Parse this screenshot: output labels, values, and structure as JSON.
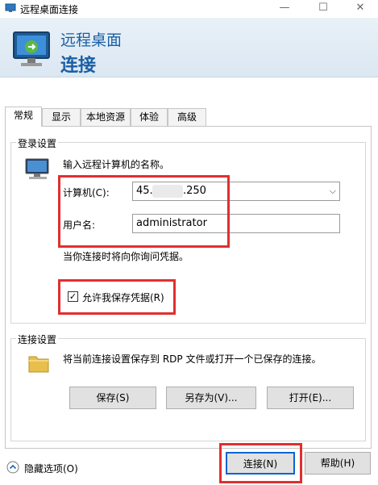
{
  "window": {
    "title": "远程桌面连接",
    "minimize": "—",
    "maximize": "☐",
    "close": "✕"
  },
  "banner": {
    "subtitle": "远程桌面",
    "title": "连接"
  },
  "tabs": [
    {
      "label": "常规",
      "active": true
    },
    {
      "label": "显示",
      "active": false
    },
    {
      "label": "本地资源",
      "active": false
    },
    {
      "label": "体验",
      "active": false
    },
    {
      "label": "高级",
      "active": false
    }
  ],
  "login": {
    "group_title": "登录设置",
    "instruction": "输入远程计算机的名称。",
    "computer_label": "计算机(C):",
    "computer_value_prefix": "45.1",
    "computer_value_suffix": ".250",
    "username_label": "用户名:",
    "username_value": "administrator",
    "credential_note": "当你连接时将向你询问凭据。",
    "save_credentials_label": "允许我保存凭据(R)",
    "save_credentials_checked": true
  },
  "connection": {
    "group_title": "连接设置",
    "description": "将当前连接设置保存到 RDP 文件或打开一个已保存的连接。",
    "save_label": "保存(S)",
    "save_as_label": "另存为(V)...",
    "open_label": "打开(E)..."
  },
  "footer": {
    "hide_options_label": "隐藏选项(O)",
    "connect_label": "连接(N)",
    "help_label": "帮助(H)"
  },
  "colors": {
    "accent": "#1a5fa5",
    "highlight_box": "#e02f2f",
    "primary_border": "#0a64d2"
  },
  "icons": {
    "app": "remote-desktop-icon",
    "banner": "remote-desktop-monitor-icon",
    "login": "computer-monitor-icon",
    "connection": "folder-icon",
    "options": "chevron-up-circle-icon"
  }
}
